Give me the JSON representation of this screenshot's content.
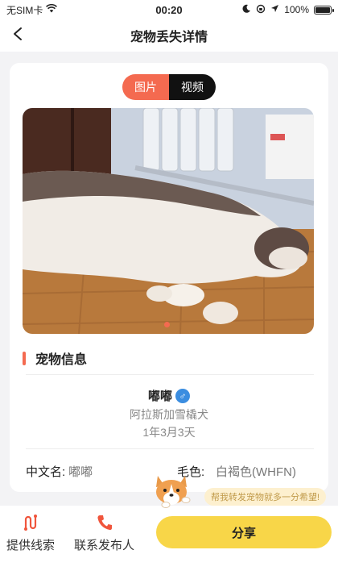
{
  "status_bar": {
    "carrier": "无SIM卡",
    "time": "00:20",
    "battery_percent": "100%",
    "battery_level": 1.0
  },
  "nav": {
    "title": "宠物丢失详情",
    "back_icon": "chevron-left-icon"
  },
  "media_toggle": {
    "photo_label": "图片",
    "video_label": "视频",
    "selected": "图片"
  },
  "gallery": {
    "current_index": 1,
    "total": 1,
    "accent_color": "#f46a50"
  },
  "section": {
    "title": "宠物信息"
  },
  "pet": {
    "name": "嘟嘟",
    "gender_symbol": "♂",
    "breed": "阿拉斯加雪橇犬",
    "age": "1年3月3天"
  },
  "info": {
    "chinese_name_label": "中文名:",
    "chinese_name_value": "嘟嘟",
    "fur_color_label": "毛色:",
    "fur_color_value": "白褐色(WHFN)"
  },
  "share_prompt": "帮我转发宠物就多一分希望!",
  "bottom_bar": {
    "clues_label": "提供线索",
    "contact_label": "联系发布人",
    "share_label": "分享",
    "share_color": "#f8d648"
  }
}
